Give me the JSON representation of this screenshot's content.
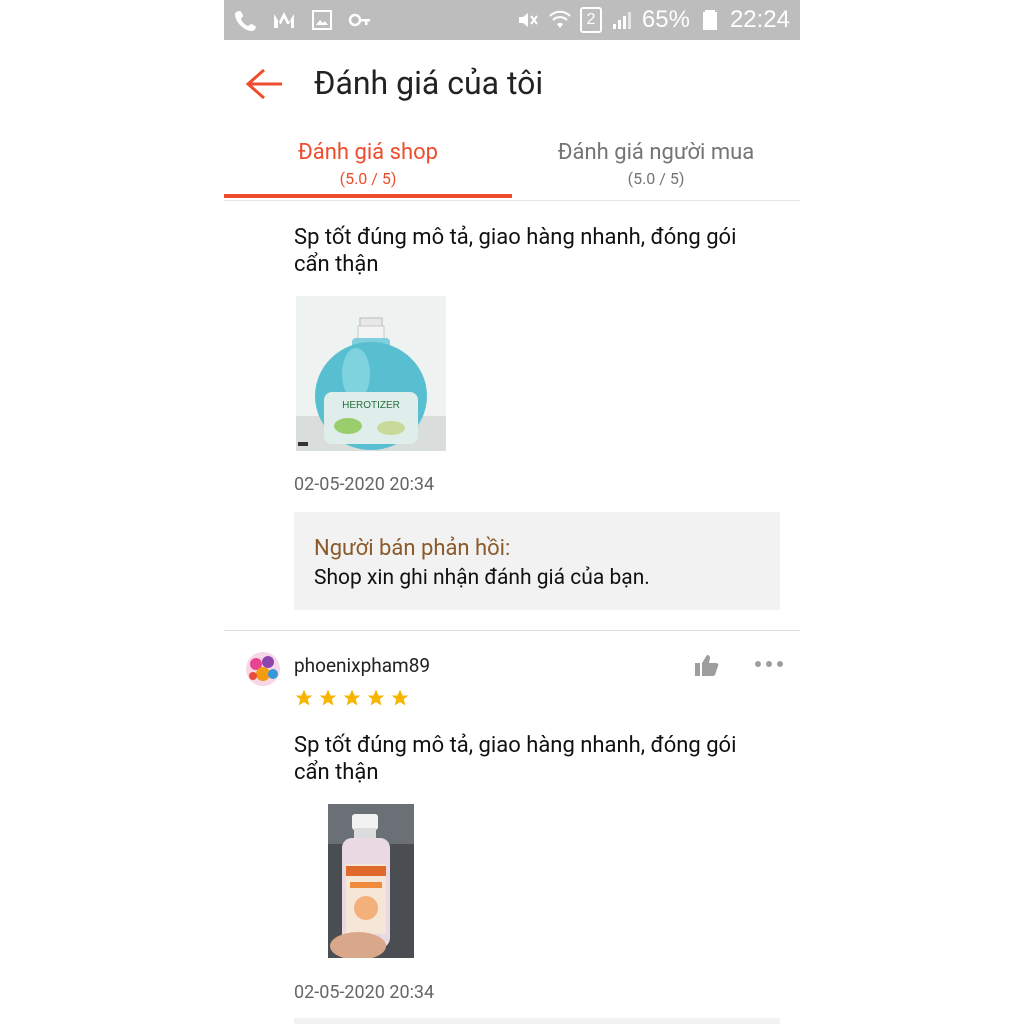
{
  "status_bar": {
    "battery": "65%",
    "time": "22:24",
    "sim": "2",
    "left_icons": [
      "phone-icon",
      "m-icon",
      "image-icon",
      "key-icon"
    ],
    "right_icons": [
      "mute-icon",
      "wifi-icon",
      "sim-icon",
      "signal-icon",
      "battery-icon"
    ]
  },
  "header": {
    "title": "Đánh giá của tôi",
    "back_icon": "arrow-left-icon"
  },
  "tabs": [
    {
      "label": "Đánh giá shop",
      "score": "(5.0 / 5)",
      "active": true
    },
    {
      "label": "Đánh giá người mua",
      "score": "(5.0 / 5)",
      "active": false
    }
  ],
  "reviews": [
    {
      "text": "Sp tốt đúng mô tả, giao hàng nhanh, đóng gói cẩn thận",
      "date": "02-05-2020 20:34",
      "photo": "blue-sanitizer-bottle",
      "seller_reply": {
        "title": "Người bán phản hồi:",
        "message": "Shop xin ghi nhận đánh giá của bạn."
      }
    },
    {
      "username": "phoenixpham89",
      "rating": 5,
      "text": "Sp tốt đúng mô tả, giao hàng nhanh, đóng gói cẩn thận",
      "date": "02-05-2020 20:34",
      "photo": "small-hand-gel-bottle"
    }
  ],
  "colors": {
    "accent": "#ee4d2d",
    "star": "#f7b500",
    "seller_title": "#8a5a2b",
    "status_bar": "#bdbdbd"
  }
}
